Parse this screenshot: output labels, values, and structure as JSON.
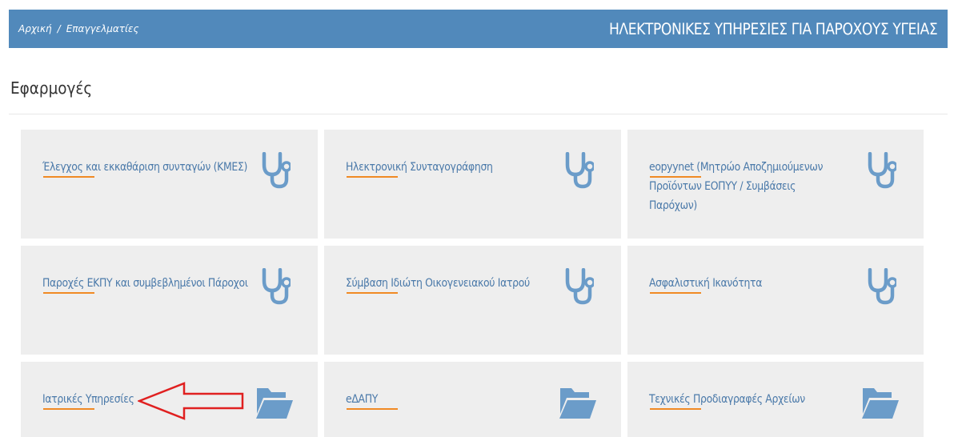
{
  "header": {
    "breadcrumb": [
      "Αρχική",
      "Επαγγελματίες"
    ],
    "breadcrumb_separator": "/",
    "title": "ΗΛΕΚΤΡΟΝΙΚΕΣ ΥΠΗΡΕΣΙΕΣ ΓΙΑ ΠΑΡΟΧΟΥΣ ΥΓΕΙΑΣ"
  },
  "section": {
    "title": "Εφαρμογές"
  },
  "tiles": [
    {
      "label": "Έλεγχος και εκκαθάριση συνταγών (ΚΜΕΣ)",
      "icon": "stethoscope-icon"
    },
    {
      "label": "Ηλεκτρονική Συνταγογράφηση",
      "icon": "stethoscope-icon"
    },
    {
      "label": "eopyynet (Μητρώο Αποζημιούμενων Προϊόντων ΕΟΠΥΥ / Συμβάσεις Παρόχων)",
      "icon": "stethoscope-icon"
    },
    {
      "label": "Παροχές ΕΚΠΥ και συμβεβλημένοι Πάροχοι",
      "icon": "stethoscope-icon"
    },
    {
      "label": "Σύμβαση Ιδιώτη Οικογενειακού Ιατρού",
      "icon": "stethoscope-icon"
    },
    {
      "label": "Ασφαλιστική Ικανότητα",
      "icon": "stethoscope-icon"
    },
    {
      "label": "Ιατρικές Υπηρεσίες",
      "icon": "folder-open-icon"
    },
    {
      "label": "eΔΑΠΥ",
      "icon": "folder-open-icon"
    },
    {
      "label": "Τεχνικές Προδιαγραφές Αρχείων",
      "icon": "folder-open-icon"
    }
  ],
  "annotation": {
    "icon": "red-arrow-icon",
    "points_to": "Ιατρικές Υπηρεσίες"
  },
  "colors": {
    "header_bg": "#5189bb",
    "tile_bg": "#eeeeee",
    "link": "#4a79a9",
    "underline": "#f08a24",
    "icon": "#6b9cc9",
    "arrow": "#e02020"
  }
}
